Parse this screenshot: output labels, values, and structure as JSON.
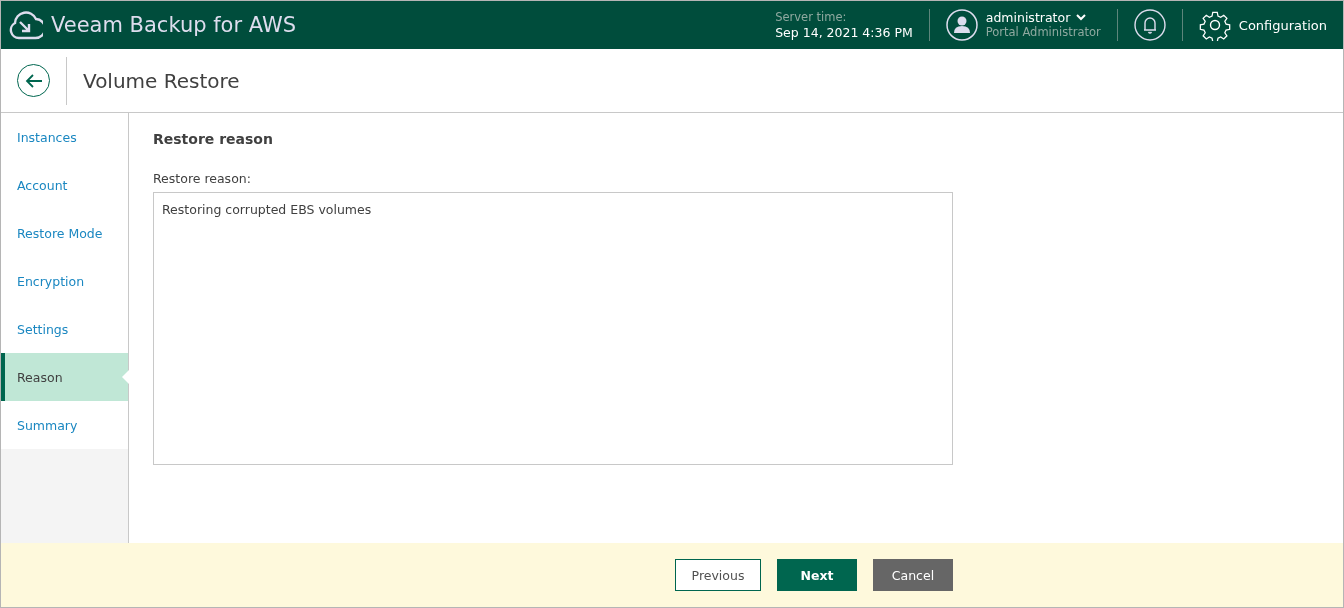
{
  "header": {
    "app_title": "Veeam Backup for AWS",
    "server_time_label": "Server time:",
    "server_time": "Sep 14, 2021 4:36 PM",
    "user_name": "administrator",
    "user_role": "Portal Administrator",
    "configuration": "Configuration"
  },
  "page": {
    "title": "Volume Restore"
  },
  "steps": [
    {
      "label": "Instances",
      "selected": false
    },
    {
      "label": "Account",
      "selected": false
    },
    {
      "label": "Restore Mode",
      "selected": false
    },
    {
      "label": "Encryption",
      "selected": false
    },
    {
      "label": "Settings",
      "selected": false
    },
    {
      "label": "Reason",
      "selected": true
    },
    {
      "label": "Summary",
      "selected": false
    }
  ],
  "form": {
    "heading": "Restore reason",
    "field_label": "Restore reason:",
    "field_value": "Restoring corrupted EBS volumes"
  },
  "buttons": [
    {
      "label": "Previous",
      "kind": "secondary"
    },
    {
      "label": "Next",
      "kind": "primary"
    },
    {
      "label": "Cancel",
      "kind": "neutral"
    }
  ]
}
